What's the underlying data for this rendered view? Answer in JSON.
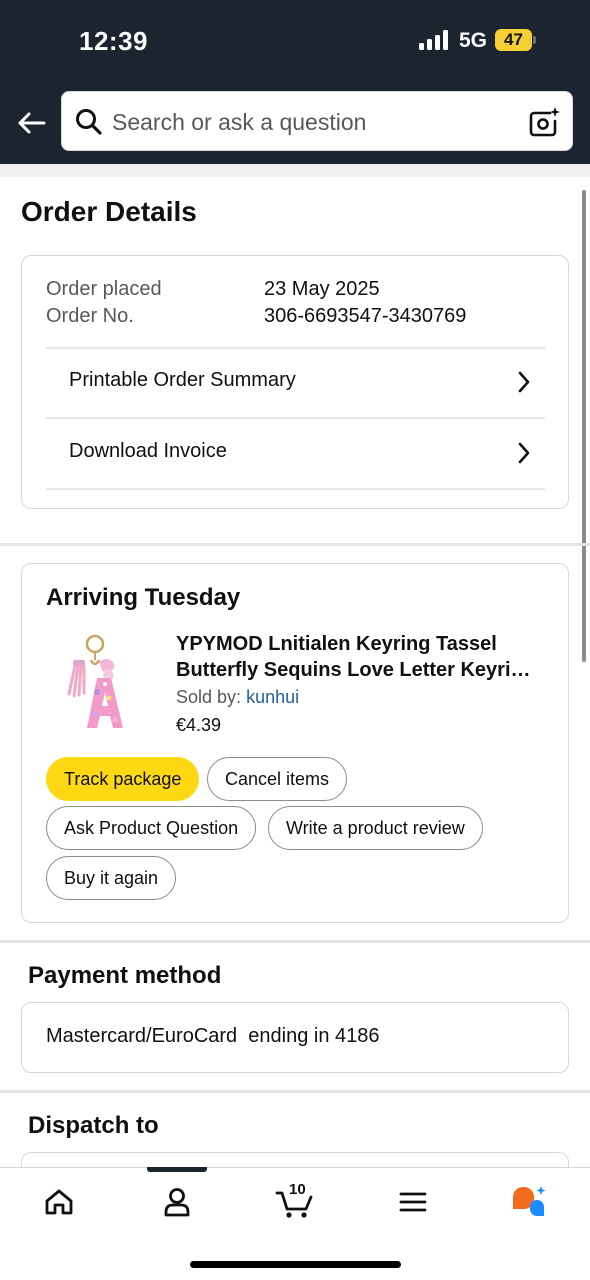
{
  "status_bar": {
    "time": "12:39",
    "network": "5G",
    "battery": "47"
  },
  "search": {
    "placeholder": "Search or ask a question"
  },
  "icons": {
    "back": "arrow-left-icon",
    "search": "magnifier-icon",
    "camera": "camera-lens-icon",
    "chevron": "chevron-right-icon",
    "home": "home-icon",
    "account": "person-icon",
    "cart": "cart-icon",
    "menu": "hamburger-menu-icon",
    "assistant": "assistant-bubbles-icon"
  },
  "page": {
    "title": "Order Details"
  },
  "order": {
    "placed_label": "Order placed",
    "placed_value": "23 May 2025",
    "number_label": "Order No.",
    "number_value": "306-6693547-3430769",
    "links": [
      "Printable Order Summary",
      "Download Invoice"
    ]
  },
  "shipment": {
    "status": "Arriving Tuesday",
    "product_title_line1": "YPYMOD Lnitialen Keyring Tassel",
    "product_title_line2": "Butterfly Sequins Love Letter Keyri…",
    "sold_by_label": "Sold by:",
    "seller": "kunhui",
    "price": "€4.39",
    "actions": {
      "track": "Track package",
      "cancel": "Cancel items",
      "ask": "Ask Product Question",
      "review": "Write a product review",
      "buy_again": "Buy it again"
    }
  },
  "payment": {
    "title": "Payment method",
    "text": "Mastercard/EuroCard  ending in 4186"
  },
  "dispatch": {
    "title": "Dispatch to"
  },
  "tabbar": {
    "cart_count": "10"
  },
  "colors": {
    "header_bg": "#1c2430",
    "primary_button": "#ffd814",
    "link": "#2162a1",
    "assistant_orange": "#f26b1d",
    "assistant_blue": "#1a8cff"
  }
}
